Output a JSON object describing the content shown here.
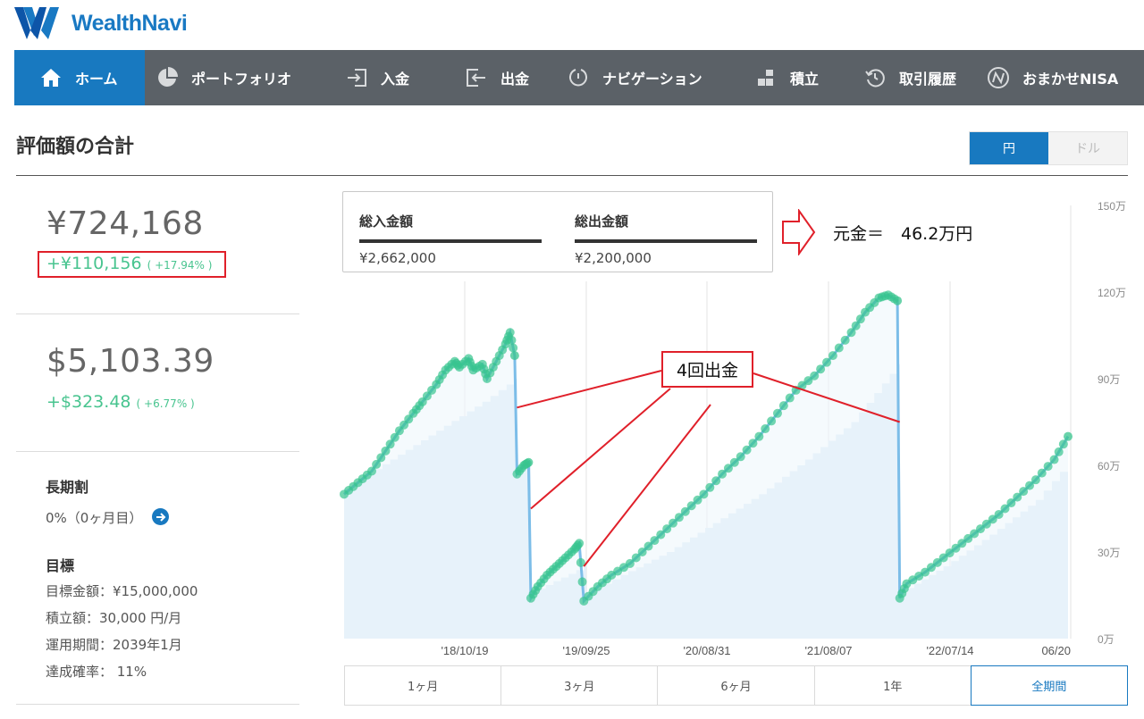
{
  "brand": {
    "name": "WealthNavi"
  },
  "nav": {
    "items": [
      {
        "label": "ホーム",
        "icon": "home-icon",
        "active": true
      },
      {
        "label": "ポートフォリオ",
        "icon": "pie-chart-icon"
      },
      {
        "label": "入金",
        "icon": "deposit-icon"
      },
      {
        "label": "出金",
        "icon": "withdraw-icon"
      },
      {
        "label": "ナビゲーション",
        "icon": "navigation-icon"
      },
      {
        "label": "積立",
        "icon": "blocks-icon"
      },
      {
        "label": "取引履歴",
        "icon": "history-icon"
      },
      {
        "label": "おまかせNISA",
        "icon": "nisa-icon"
      }
    ]
  },
  "section": {
    "title": "評価額の合計"
  },
  "currency_toggle": {
    "yen": "円",
    "dollar": "ドル",
    "selected": "円"
  },
  "summary": {
    "yen_total": "¥724,168",
    "yen_change": "+¥110,156",
    "yen_change_pct": "( +17.94% )",
    "usd_total": "$5,103.39",
    "usd_change": "+$323.48",
    "usd_change_pct": "( +6.77% )"
  },
  "long_term": {
    "heading": "長期割",
    "value": "0%（0ヶ月目）"
  },
  "goal": {
    "heading": "目標",
    "target_amount": "目標金額：¥15,000,000",
    "monthly": "積立額：30,000 円/月",
    "period": "運用期間：2039年1月",
    "probability": "達成確率： 11%"
  },
  "tooltip": {
    "deposit_label": "総入金額",
    "deposit_value": "¥2,662,000",
    "withdraw_label": "総出金額",
    "withdraw_value": "¥2,200,000"
  },
  "annotations": {
    "principal": "元金＝　46.2万円",
    "withdrawals": "4回出金"
  },
  "periods": [
    {
      "label": "1ヶ月"
    },
    {
      "label": "3ヶ月"
    },
    {
      "label": "6ヶ月"
    },
    {
      "label": "1年"
    },
    {
      "label": "全期間",
      "active": true
    }
  ],
  "chart_data": {
    "type": "area",
    "x_tick_labels": [
      "'18/10/19",
      "'19/09/25",
      "'20/08/31",
      "'21/08/07",
      "'22/07/14",
      "06/20"
    ],
    "y_tick_labels": [
      "0万",
      "30万",
      "60万",
      "90万",
      "120万",
      "150万"
    ],
    "ylim": [
      0,
      150
    ],
    "y_unit": "万円",
    "series": [
      {
        "role": "valuation",
        "color": "#7cbde8",
        "points": [
          [
            0,
            50
          ],
          [
            0.03,
            54
          ],
          [
            0.06,
            58
          ],
          [
            0.09,
            65
          ],
          [
            0.12,
            72
          ],
          [
            0.15,
            78
          ],
          [
            0.17,
            82
          ],
          [
            0.2,
            88
          ],
          [
            0.22,
            93
          ],
          [
            0.24,
            96
          ],
          [
            0.25,
            94
          ],
          [
            0.27,
            97
          ],
          [
            0.28,
            93
          ],
          [
            0.3,
            95
          ],
          [
            0.31,
            90
          ],
          [
            0.33,
            96
          ],
          [
            0.35,
            102
          ],
          [
            0.36,
            106
          ],
          [
            0.37,
            98
          ],
          [
            0.375,
            57
          ],
          [
            0.39,
            60
          ],
          [
            0.4,
            61
          ],
          [
            0.405,
            14
          ],
          [
            0.42,
            18
          ],
          [
            0.44,
            22
          ],
          [
            0.46,
            25
          ],
          [
            0.48,
            28
          ],
          [
            0.5,
            31
          ],
          [
            0.51,
            33
          ],
          [
            0.52,
            13
          ],
          [
            0.55,
            18
          ],
          [
            0.58,
            22
          ],
          [
            0.62,
            26
          ],
          [
            0.66,
            32
          ],
          [
            0.7,
            38
          ],
          [
            0.74,
            44
          ],
          [
            0.78,
            50
          ],
          [
            0.82,
            57
          ],
          [
            0.86,
            63
          ],
          [
            0.9,
            70
          ],
          [
            0.94,
            78
          ],
          [
            0.98,
            86
          ],
          [
            1.02,
            91
          ],
          [
            1.06,
            98
          ],
          [
            1.1,
            106
          ],
          [
            1.13,
            113
          ],
          [
            1.16,
            118
          ],
          [
            1.18,
            119
          ],
          [
            1.2,
            117
          ],
          [
            1.205,
            14
          ],
          [
            1.22,
            19
          ],
          [
            1.26,
            23
          ],
          [
            1.3,
            28
          ],
          [
            1.34,
            33
          ],
          [
            1.38,
            38
          ],
          [
            1.42,
            43
          ],
          [
            1.46,
            49
          ],
          [
            1.5,
            55
          ],
          [
            1.54,
            62
          ],
          [
            1.57,
            70
          ]
        ]
      },
      {
        "role": "principal",
        "color": "#e6f1fa",
        "points": [
          [
            0,
            52
          ],
          [
            0.1,
            62
          ],
          [
            0.2,
            72
          ],
          [
            0.3,
            82
          ],
          [
            0.37,
            90
          ],
          [
            0.375,
            60
          ],
          [
            0.4,
            60
          ],
          [
            0.405,
            16
          ],
          [
            0.52,
            25
          ],
          [
            0.525,
            16
          ],
          [
            0.6,
            22
          ],
          [
            0.7,
            30
          ],
          [
            0.8,
            40
          ],
          [
            0.9,
            50
          ],
          [
            1.0,
            62
          ],
          [
            1.1,
            75
          ],
          [
            1.15,
            85
          ],
          [
            1.2,
            95
          ],
          [
            1.205,
            16
          ],
          [
            1.3,
            25
          ],
          [
            1.4,
            36
          ],
          [
            1.5,
            48
          ],
          [
            1.57,
            61
          ]
        ]
      }
    ],
    "withdrawals_count": 4
  }
}
